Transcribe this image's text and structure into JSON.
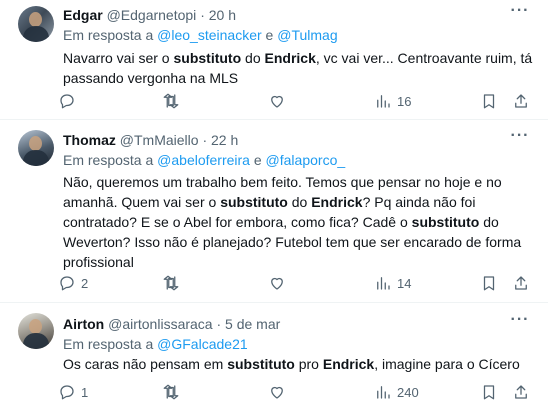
{
  "tweets": [
    {
      "name": "Edgar",
      "handle": "@Edgarnetopi",
      "sep": "·",
      "time": "20 h",
      "reply_prefix": "Em resposta a ",
      "mention1": "@leo_steinacker",
      "reply_and": " e ",
      "mention2": "@Tulmag",
      "text_parts": [
        "Navarro vai ser o ",
        "substituto",
        " do ",
        "Endrick",
        ", vc vai ver... Centroavante ruim, tá passando vergonha na MLS"
      ],
      "replies": "",
      "retweets": "",
      "likes": "",
      "views": "16"
    },
    {
      "name": "Thomaz",
      "handle": "@TmMaiello",
      "sep": "·",
      "time": "22 h",
      "reply_prefix": "Em resposta a ",
      "mention1": "@abeloferreira",
      "reply_and": " e ",
      "mention2": "@falaporco_",
      "text_parts": [
        "Não, queremos um trabalho bem feito. Temos que pensar no hoje e no amanhã. Quem vai ser o ",
        "substituto",
        " do ",
        "Endrick",
        "? Pq ainda não foi contratado? E se o Abel for embora, como fica? Cadê o ",
        "substituto",
        " do Weverton? Isso não é planejado? Futebol tem que ser encarado de forma profissional"
      ],
      "replies": "2",
      "retweets": "",
      "likes": "",
      "views": "14"
    },
    {
      "name": "Airton",
      "handle": "@airtonlissaraca",
      "sep": "·",
      "time": "5 de mar",
      "reply_prefix": "Em resposta a ",
      "mention1": "@GFalcade21",
      "reply_and": "",
      "mention2": "",
      "text_parts": [
        "Os caras não pensam em ",
        "substituto",
        " pro ",
        "Endrick",
        ", imagine para o Cícero"
      ],
      "replies": "1",
      "retweets": "",
      "likes": "",
      "views": "240"
    }
  ],
  "icons": {
    "reply": "reply-icon",
    "retweet": "retweet-icon",
    "like": "heart-icon",
    "views": "views-icon",
    "bookmark": "bookmark-icon",
    "share": "share-icon",
    "more": "more-icon"
  },
  "colors": {
    "link": "#1d9bf0",
    "muted": "#536471",
    "text": "#0f1419"
  }
}
